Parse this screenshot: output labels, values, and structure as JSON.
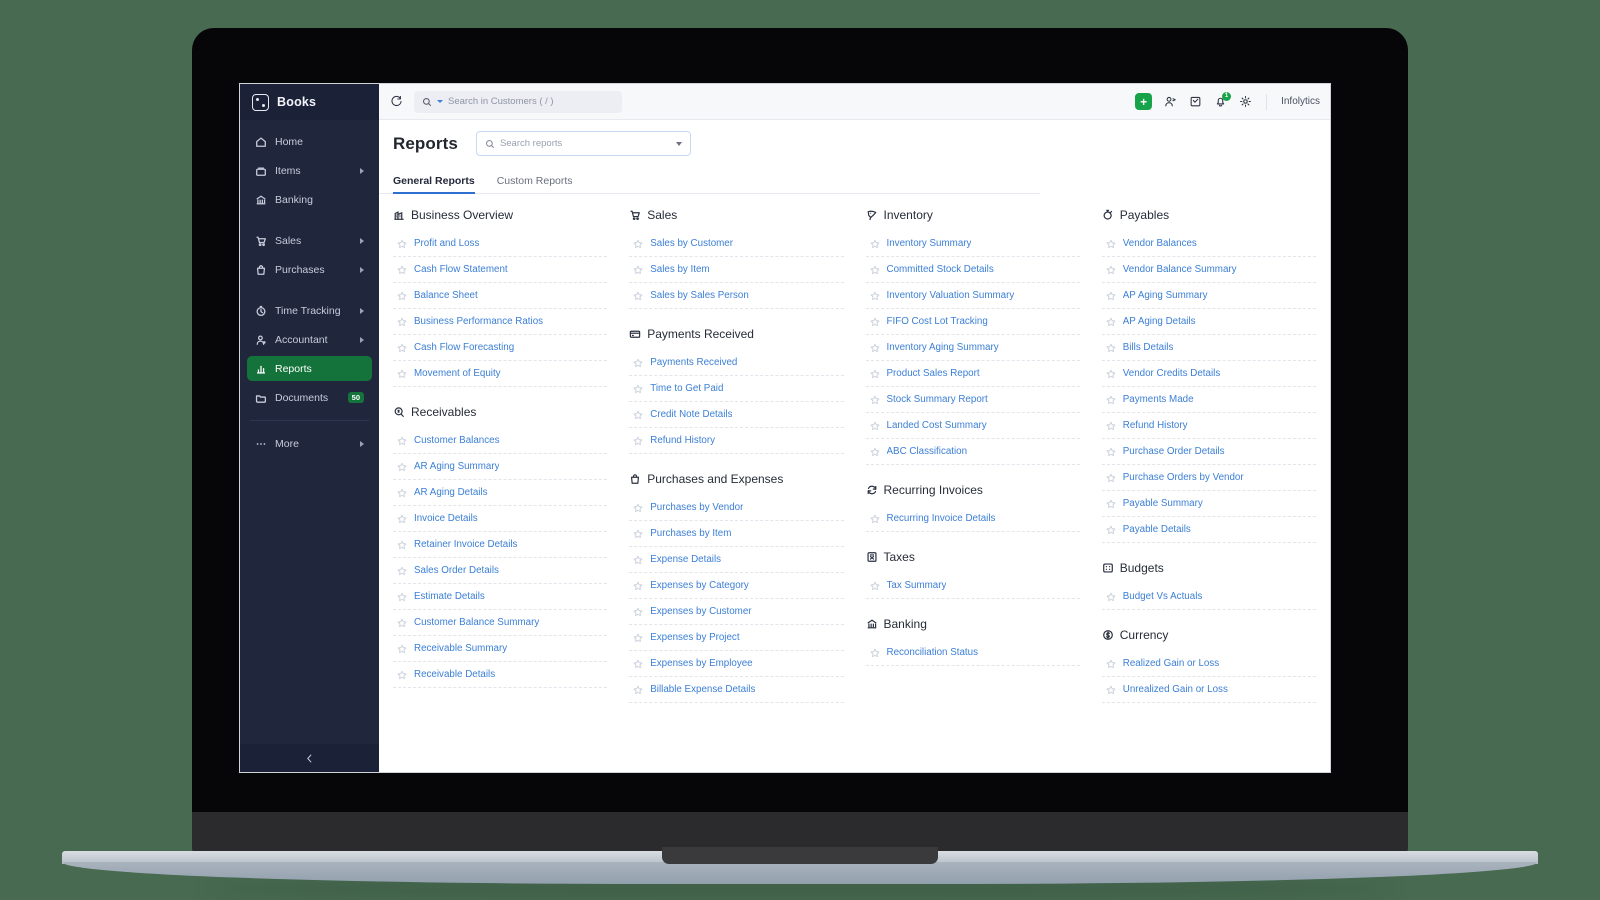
{
  "app": {
    "brand": "Books"
  },
  "sidebar": {
    "items": [
      {
        "label": "Home",
        "icon": "home-icon",
        "arrow": false,
        "active": false
      },
      {
        "label": "Items",
        "icon": "box-icon",
        "arrow": true,
        "active": false
      },
      {
        "label": "Banking",
        "icon": "bank-icon",
        "arrow": false,
        "active": false
      },
      {
        "gap": true
      },
      {
        "label": "Sales",
        "icon": "cart-icon",
        "arrow": true,
        "active": false
      },
      {
        "label": "Purchases",
        "icon": "bag-icon",
        "arrow": true,
        "active": false
      },
      {
        "gap": true
      },
      {
        "label": "Time Tracking",
        "icon": "clock-icon",
        "arrow": true,
        "active": false
      },
      {
        "label": "Accountant",
        "icon": "user-icon",
        "arrow": true,
        "active": false
      },
      {
        "label": "Reports",
        "icon": "chart-bar-icon",
        "arrow": false,
        "active": true
      },
      {
        "label": "Documents",
        "icon": "folder-icon",
        "arrow": false,
        "active": false,
        "badge": "50"
      },
      {
        "divider": true
      },
      {
        "label": "More",
        "icon": "ellipsis-icon",
        "arrow": true,
        "active": false
      }
    ],
    "collapse_icon": "chevron-left-icon"
  },
  "topbar": {
    "refresh_icon": "refresh-icon",
    "search": {
      "placeholder": "Search in Customers ( / )",
      "icon": "search-icon",
      "dropdown_icon": "chevron-down-icon"
    },
    "add_label": "+",
    "icons": [
      {
        "name": "people-icon"
      },
      {
        "name": "calendar-check-icon"
      },
      {
        "name": "bell-icon",
        "badge": "1"
      },
      {
        "name": "gear-icon"
      }
    ],
    "org_name": "Infolytics"
  },
  "page": {
    "title": "Reports",
    "search": {
      "placeholder": "Search reports",
      "icon": "search-icon",
      "chevron": "chevron-down-icon"
    },
    "tabs": [
      {
        "label": "General Reports",
        "active": true
      },
      {
        "label": "Custom Reports",
        "active": false
      }
    ]
  },
  "columns": [
    {
      "groups": [
        {
          "title": "Business Overview",
          "icon": "building-icon",
          "reports": [
            "Profit and Loss",
            "Cash Flow Statement",
            "Balance Sheet",
            "Business Performance Ratios",
            "Cash Flow Forecasting",
            "Movement of Equity"
          ]
        },
        {
          "title": "Receivables",
          "icon": "receivables-icon",
          "reports": [
            "Customer Balances",
            "AR Aging Summary",
            "AR Aging Details",
            "Invoice Details",
            "Retainer Invoice Details",
            "Sales Order Details",
            "Estimate Details",
            "Customer Balance Summary",
            "Receivable Summary",
            "Receivable Details"
          ]
        }
      ]
    },
    {
      "groups": [
        {
          "title": "Sales",
          "icon": "cart-icon",
          "reports": [
            "Sales by Customer",
            "Sales by Item",
            "Sales by Sales Person"
          ]
        },
        {
          "title": "Payments Received",
          "icon": "card-icon",
          "reports": [
            "Payments Received",
            "Time to Get Paid",
            "Credit Note Details",
            "Refund History"
          ]
        },
        {
          "title": "Purchases and Expenses",
          "icon": "bag-icon",
          "reports": [
            "Purchases by Vendor",
            "Purchases by Item",
            "Expense Details",
            "Expenses by Category",
            "Expenses by Customer",
            "Expenses by Project",
            "Expenses by Employee",
            "Billable Expense Details"
          ]
        }
      ]
    },
    {
      "groups": [
        {
          "title": "Inventory",
          "icon": "inventory-icon",
          "reports": [
            "Inventory Summary",
            "Committed Stock Details",
            "Inventory Valuation Summary",
            "FIFO Cost Lot Tracking",
            "Inventory Aging Summary",
            "Product Sales Report",
            "Stock Summary Report",
            "Landed Cost Summary",
            "ABC Classification"
          ]
        },
        {
          "title": "Recurring Invoices",
          "icon": "recurring-icon",
          "reports": [
            "Recurring Invoice Details"
          ]
        },
        {
          "title": "Taxes",
          "icon": "tax-icon",
          "reports": [
            "Tax Summary"
          ]
        },
        {
          "title": "Banking",
          "icon": "bank-icon",
          "reports": [
            "Reconciliation Status"
          ]
        }
      ]
    },
    {
      "groups": [
        {
          "title": "Payables",
          "icon": "payables-icon",
          "reports": [
            "Vendor Balances",
            "Vendor Balance Summary",
            "AP Aging Summary",
            "AP Aging Details",
            "Bills Details",
            "Vendor Credits Details",
            "Payments Made",
            "Refund History",
            "Purchase Order Details",
            "Purchase Orders by Vendor",
            "Payable Summary",
            "Payable Details"
          ]
        },
        {
          "title": "Budgets",
          "icon": "budget-icon",
          "reports": [
            "Budget Vs Actuals"
          ]
        },
        {
          "title": "Currency",
          "icon": "currency-icon",
          "reports": [
            "Realized Gain or Loss",
            "Unrealized Gain or Loss"
          ]
        }
      ]
    }
  ],
  "colors": {
    "sidebar_bg": "#20263c",
    "accent_green": "#14733a",
    "link_blue": "#3b7fd6",
    "tab_underline": "#2f6fd0",
    "page_bg": "#476a50"
  }
}
